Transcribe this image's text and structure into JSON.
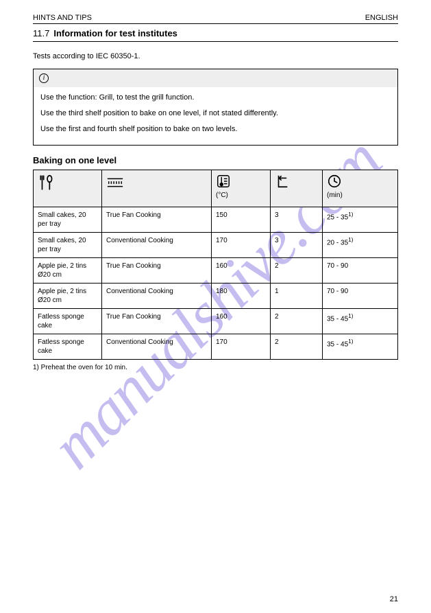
{
  "watermark": "manualshive.com",
  "header": {
    "left": "HINTS AND TIPS",
    "right": "ENGLISH"
  },
  "section": {
    "number": "11.7",
    "title": "Information for test institutes"
  },
  "intro": "Tests according to IEC 60350-1.",
  "info": {
    "p1": "Use the function: Grill, to test the grill function.",
    "p2": "Use the third shelf position to bake on one level, if not stated differently.",
    "p3": "Use the first and fourth shelf position to bake on two levels."
  },
  "subtitle": "Baking on one level",
  "table": {
    "rows": [
      {
        "food": "Small cakes, 20 per tray",
        "func": "True Fan Cooking",
        "temp": "150",
        "shelf": "3",
        "time": "25 - 35"
      },
      {
        "food": "Small cakes, 20 per tray",
        "func": "Conventional Cooking",
        "temp": "170",
        "shelf": "3",
        "time": "20 - 35"
      },
      {
        "food": "Apple pie, 2 tins Ø20 cm",
        "func": "True Fan Cooking",
        "temp": "160",
        "shelf": "2",
        "time": "70 - 90"
      },
      {
        "food": "Apple pie, 2 tins Ø20 cm",
        "func": "Conventional Cooking",
        "temp": "180",
        "shelf": "1",
        "time": "70 - 90"
      },
      {
        "food": "Fatless sponge cake",
        "func": "True Fan Cooking",
        "temp": "160",
        "shelf": "2",
        "time": "35 - 45"
      },
      {
        "food": "Fatless sponge cake",
        "func": "Conventional Cooking",
        "temp": "170",
        "shelf": "2",
        "time": "35 - 45"
      }
    ],
    "footnote": "1) Preheat the oven for 10 min."
  },
  "th": {
    "temp": "(°C)",
    "time": "(min)"
  },
  "page": "21"
}
